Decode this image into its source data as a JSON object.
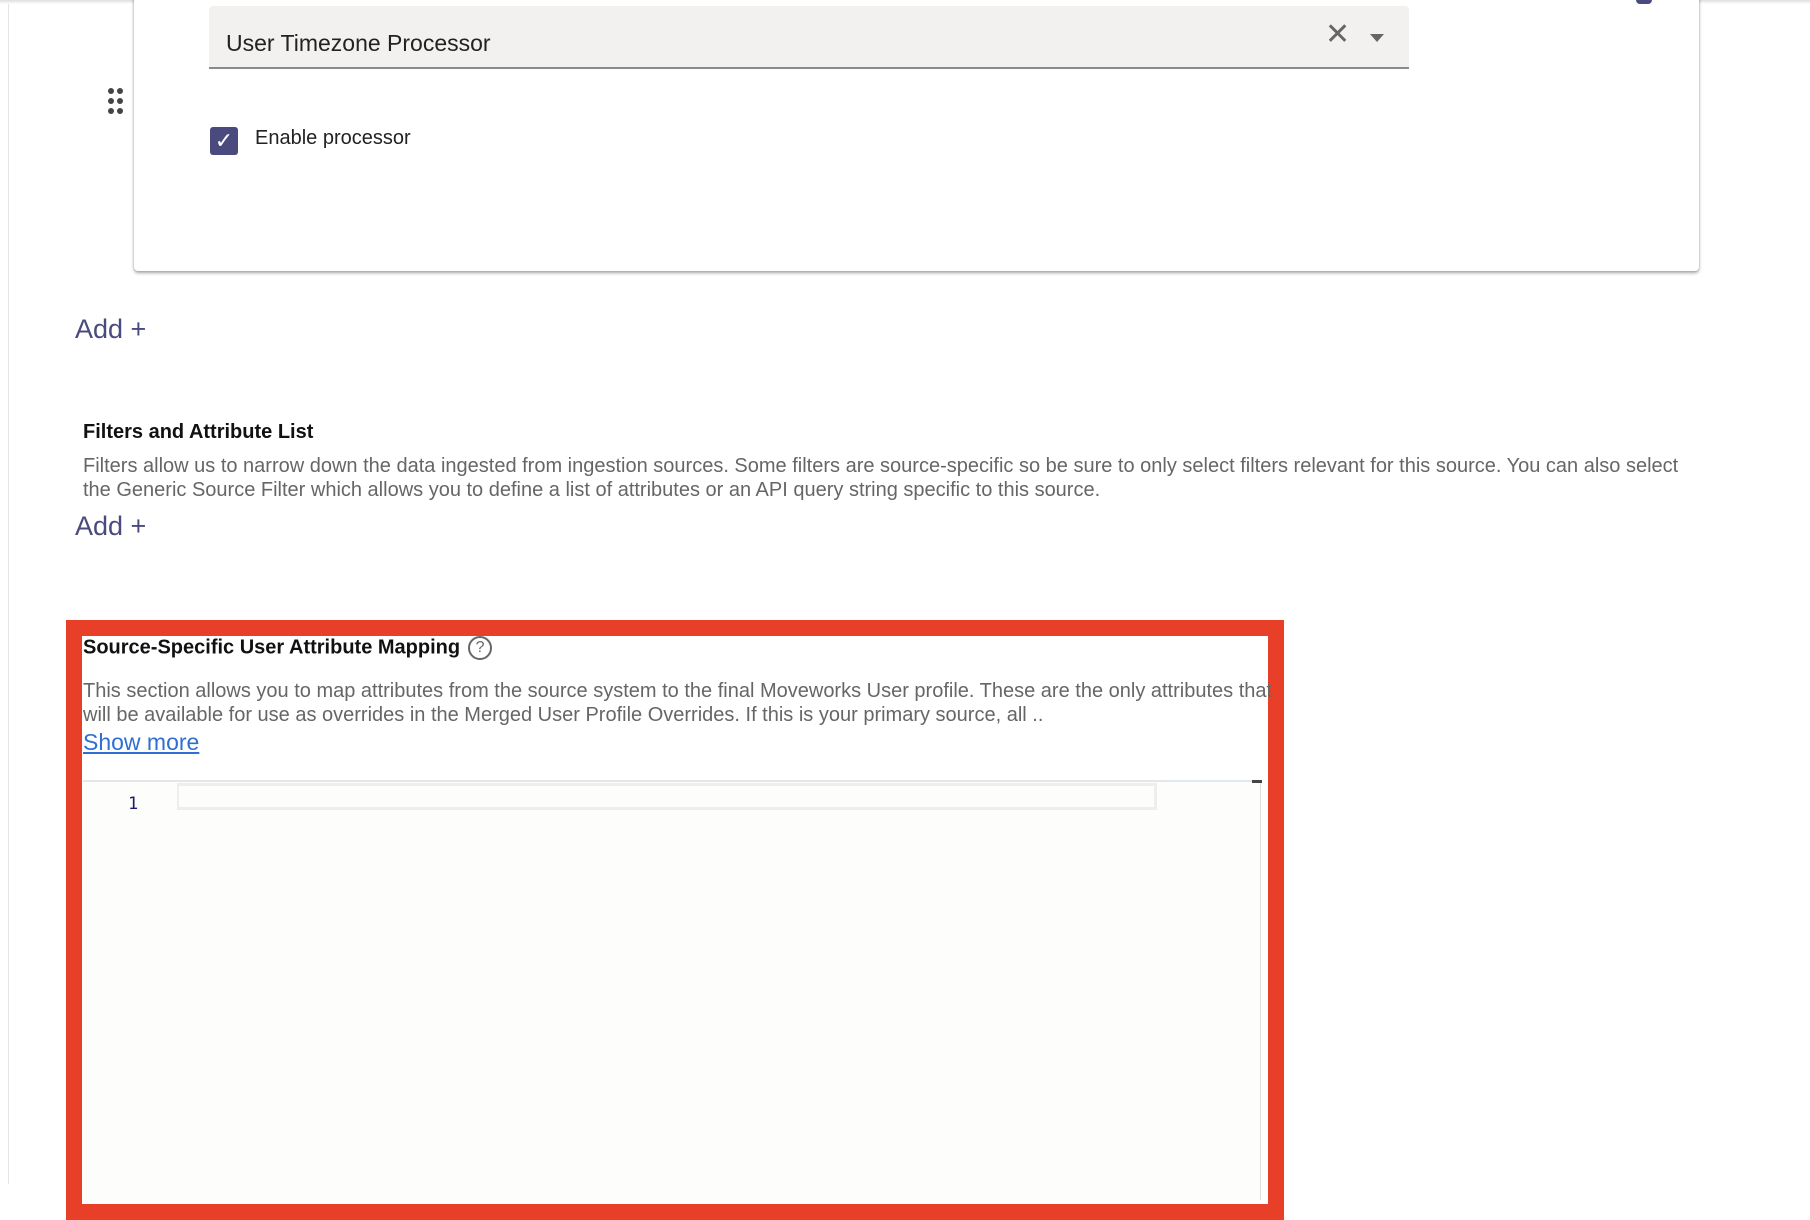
{
  "processor": {
    "selected": "User Timezone Processor",
    "enable_label": "Enable processor",
    "enabled": true
  },
  "add_processor_label": "Add +",
  "filters": {
    "heading": "Filters and Attribute List",
    "description": "Filters allow us to narrow down the data ingested from ingestion sources. Some filters are source-specific so be sure to only select filters relevant for this source. You can also select the Generic Source Filter which allows you to define a list of attributes or an API query string specific to this source.",
    "add_label": "Add +"
  },
  "mapping": {
    "heading": "Source-Specific User Attribute Mapping",
    "help": "?",
    "description": "This section allows you to map attributes from the source system to the final Moveworks User profile. These are the only attributes that will be available for use as overrides in the Merged User Profile Overrides. If this is your primary source, all ..",
    "show_more": "Show more",
    "line_number": "1"
  },
  "colors": {
    "accent": "#4a4a7e",
    "highlight": "#e84028",
    "link": "#2f6fd4"
  }
}
